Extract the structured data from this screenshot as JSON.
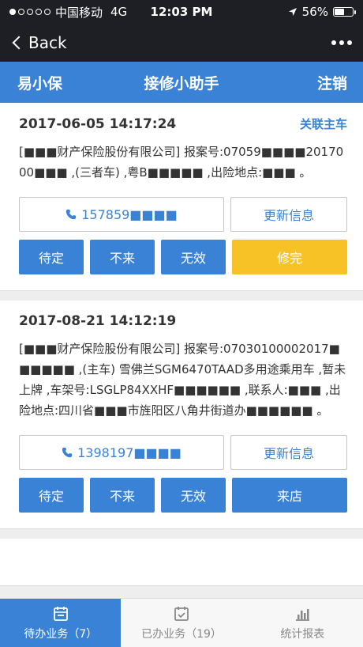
{
  "status_bar": {
    "carrier": "中国移动",
    "network": "4G",
    "time": "12:03 PM",
    "battery": "56%",
    "battery_level": 0.56
  },
  "nav": {
    "back_label": "Back"
  },
  "header": {
    "left": "易小保",
    "title": "接修小助手",
    "right": "注销"
  },
  "cards": [
    {
      "timestamp": "2017-06-05 14:17:24",
      "link": "关联主车",
      "description": "[■■■财产保险股份有限公司] 报案号:07059■■■■2017000■■■ ,(三者车) ,粤B■■■■■ ,出险地点:■■■ 。",
      "phone": "157859■■■■",
      "update_label": "更新信息",
      "actions": [
        "待定",
        "不来",
        "无效",
        "修完"
      ]
    },
    {
      "timestamp": "2017-08-21 14:12:19",
      "link": "",
      "description": "[■■■财产保险股份有限公司] 报案号:07030100002017■■■■■■ ,(主车) 雪佛兰SGM6470TAAD多用途乘用车 ,暂未上牌 ,车架号:LSGLP84XXHF■■■■■■ ,联系人:■■■ ,出险地点:四川省■■■市旌阳区八角井街道办■■■■■■ 。",
      "phone": "1398197■■■■",
      "update_label": "更新信息",
      "actions": [
        "待定",
        "不来",
        "无效",
        "来店"
      ]
    }
  ],
  "tabs": [
    {
      "label": "待办业务（7）",
      "icon": "calendar-icon"
    },
    {
      "label": "已办业务（19）",
      "icon": "calendar-check-icon"
    },
    {
      "label": "统计报表",
      "icon": "bar-chart-icon"
    }
  ],
  "colors": {
    "primary": "#3a82d6",
    "accent_yellow": "#f6c226",
    "dark_bar": "#1e1f24"
  }
}
